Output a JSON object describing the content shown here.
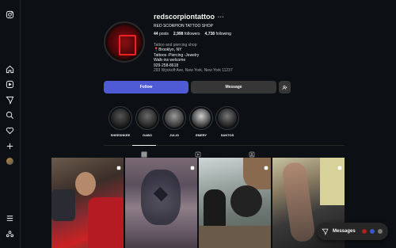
{
  "sidebar": {
    "top_icon": "instagram-icon",
    "items": [
      {
        "name": "home-icon"
      },
      {
        "name": "reels-icon"
      },
      {
        "name": "explore-icon"
      },
      {
        "name": "search-icon"
      },
      {
        "name": "notifications-icon"
      },
      {
        "name": "create-icon"
      },
      {
        "name": "profile-avatar"
      }
    ],
    "bottom": [
      {
        "name": "menu-icon"
      },
      {
        "name": "threads-icon"
      }
    ]
  },
  "profile": {
    "username": "redscorpiontattoo",
    "more": "···",
    "full_name": "RED SCORPION TATTOO SHOP",
    "posts_count": "44",
    "posts_label": "posts",
    "followers_count": "2,998",
    "followers_label": "followers",
    "following_count": "4,738",
    "following_label": "following",
    "category": "Tattoo and piercing shop",
    "bio_lines": [
      "📍Brooklyn, NY",
      "Tattoos -Piercing -Jewelry",
      "Walk-ins welcome",
      "929-258-8618"
    ],
    "address": "293 Wyckoff Ave, New York, New York 11237"
  },
  "actions": {
    "follow": "Follow",
    "message": "Message"
  },
  "highlights": [
    {
      "label": "SHEESHKEE"
    },
    {
      "label": "GABO"
    },
    {
      "label": "JULIO"
    },
    {
      "label": "EMERY"
    },
    {
      "label": "SANTOS"
    }
  ],
  "tabs": [
    {
      "name": "posts-grid-icon",
      "active": true
    },
    {
      "name": "reels-tab-icon",
      "active": false
    },
    {
      "name": "tagged-tab-icon",
      "active": false
    }
  ],
  "messages": {
    "label": "Messages"
  },
  "colors": {
    "background": "#0c1014",
    "follow_button": "#4f5bd5",
    "secondary_button": "#363636"
  }
}
